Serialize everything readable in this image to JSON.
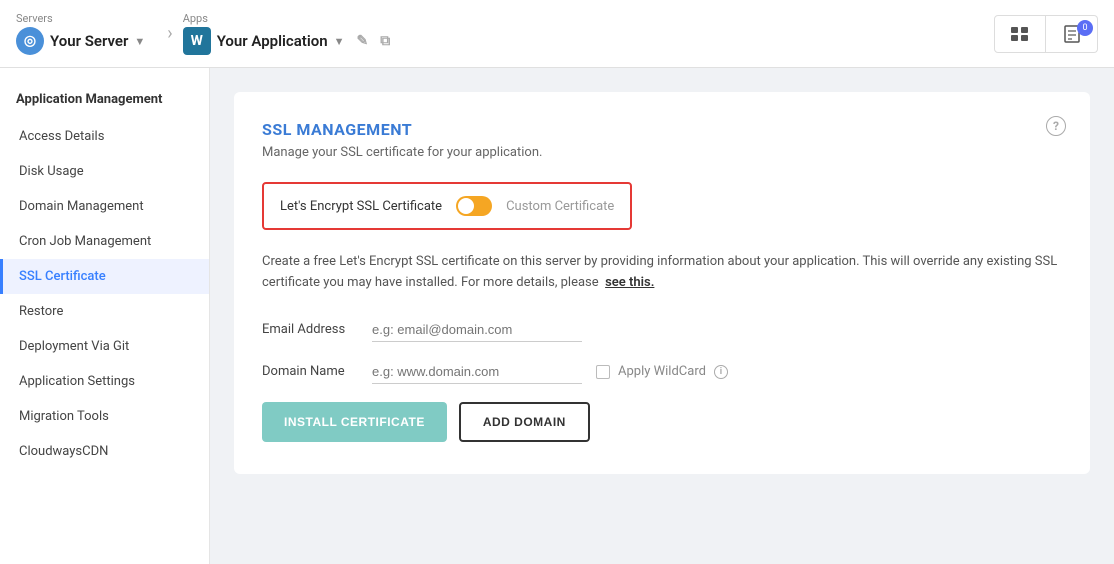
{
  "topnav": {
    "servers_label": "Servers",
    "server_name": "Your Server",
    "apps_label": "Apps",
    "app_name": "Your Application",
    "badge_count": "0"
  },
  "sidebar": {
    "section_title": "Application Management",
    "items": [
      {
        "label": "Access Details",
        "id": "access-details",
        "active": false
      },
      {
        "label": "Disk Usage",
        "id": "disk-usage",
        "active": false
      },
      {
        "label": "Domain Management",
        "id": "domain-management",
        "active": false
      },
      {
        "label": "Cron Job Management",
        "id": "cron-job-management",
        "active": false
      },
      {
        "label": "SSL Certificate",
        "id": "ssl-certificate",
        "active": true
      },
      {
        "label": "Restore",
        "id": "restore",
        "active": false
      },
      {
        "label": "Deployment Via Git",
        "id": "deployment-via-git",
        "active": false
      },
      {
        "label": "Application Settings",
        "id": "application-settings",
        "active": false
      },
      {
        "label": "Migration Tools",
        "id": "migration-tools",
        "active": false
      },
      {
        "label": "CloudwaysCDN",
        "id": "cloudways-cdn",
        "active": false
      }
    ]
  },
  "content": {
    "title": "SSL MANAGEMENT",
    "subtitle": "Manage your SSL certificate for your application.",
    "toggle_lets_encrypt": "Let's Encrypt SSL Certificate",
    "toggle_custom": "Custom Certificate",
    "description": "Create a free Let's Encrypt SSL certificate on this server by providing information about your application. This will override any existing SSL certificate you may have installed. For more details, please",
    "description_link": "see this.",
    "email_label": "Email Address",
    "email_placeholder": "e.g: email@domain.com",
    "domain_label": "Domain Name",
    "domain_placeholder": "e.g: www.domain.com",
    "wildcard_label": "Apply WildCard",
    "btn_install": "INSTALL CERTIFICATE",
    "btn_add_domain": "ADD DOMAIN"
  }
}
